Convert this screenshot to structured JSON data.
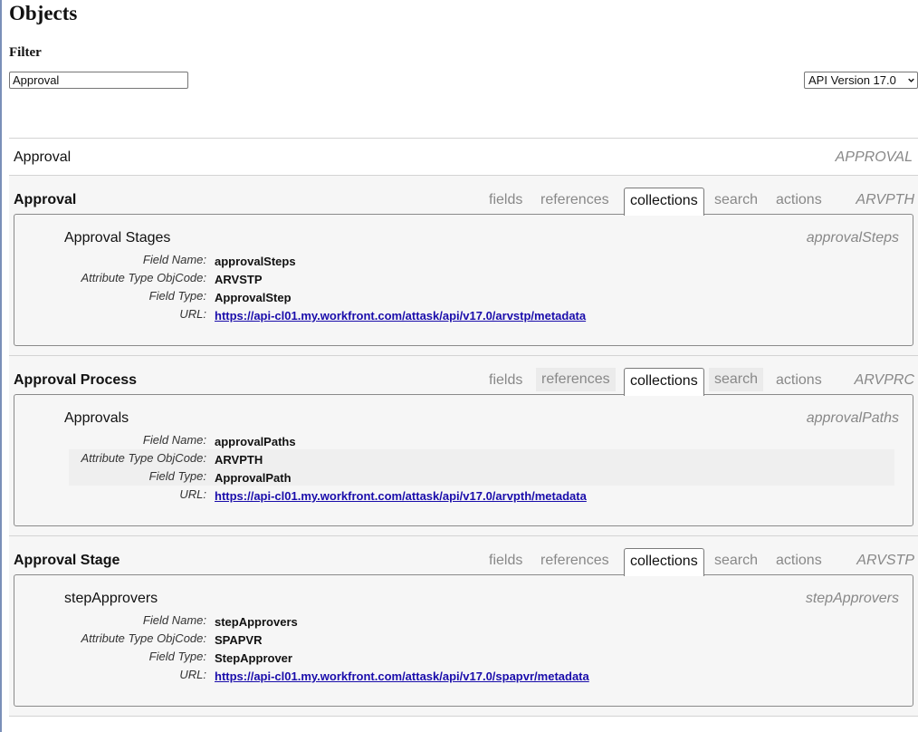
{
  "page": {
    "title": "Objects"
  },
  "filter": {
    "label": "Filter",
    "value": "Approval"
  },
  "api_version": {
    "selected": "API Version 17.0"
  },
  "object_row": {
    "label": "Approval",
    "code": "APPROVAL"
  },
  "tab_labels": {
    "fields": "fields",
    "references": "references",
    "collections": "collections",
    "search": "search",
    "actions": "actions"
  },
  "attr_labels": {
    "field_name": "Field Name:",
    "attr_type": "Attribute Type ObjCode:",
    "field_type": "Field Type:",
    "url": "URL:"
  },
  "entities": [
    {
      "title": "Approval",
      "code": "ARVPTH",
      "active_tab": "collections",
      "collection": {
        "name": "Approval Stages",
        "field_name": "approvalSteps",
        "attr_type": "ARVSTP",
        "field_type": "ApprovalStep",
        "url": "https://api-cl01.my.workfront.com/attask/api/v17.0/arvstp/metadata"
      }
    },
    {
      "title": "Approval Process",
      "code": "ARVPRC",
      "active_tab": "collections",
      "collection": {
        "name": "Approvals",
        "field_name": "approvalPaths",
        "attr_type": "ARVPTH",
        "field_type": "ApprovalPath",
        "url": "https://api-cl01.my.workfront.com/attask/api/v17.0/arvpth/metadata"
      }
    },
    {
      "title": "Approval Stage",
      "code": "ARVSTP",
      "active_tab": "collections",
      "collection": {
        "name": "stepApprovers",
        "field_name": "stepApprovers",
        "attr_type": "SPAPVR",
        "field_type": "StepApprover",
        "url": "https://api-cl01.my.workfront.com/attask/api/v17.0/spapvr/metadata"
      }
    }
  ],
  "colors": {
    "link": "#1a0dab",
    "muted": "#888888",
    "panel_bg": "#f6f6f6"
  },
  "icons": {
    "select": "chevron-down-icon"
  }
}
